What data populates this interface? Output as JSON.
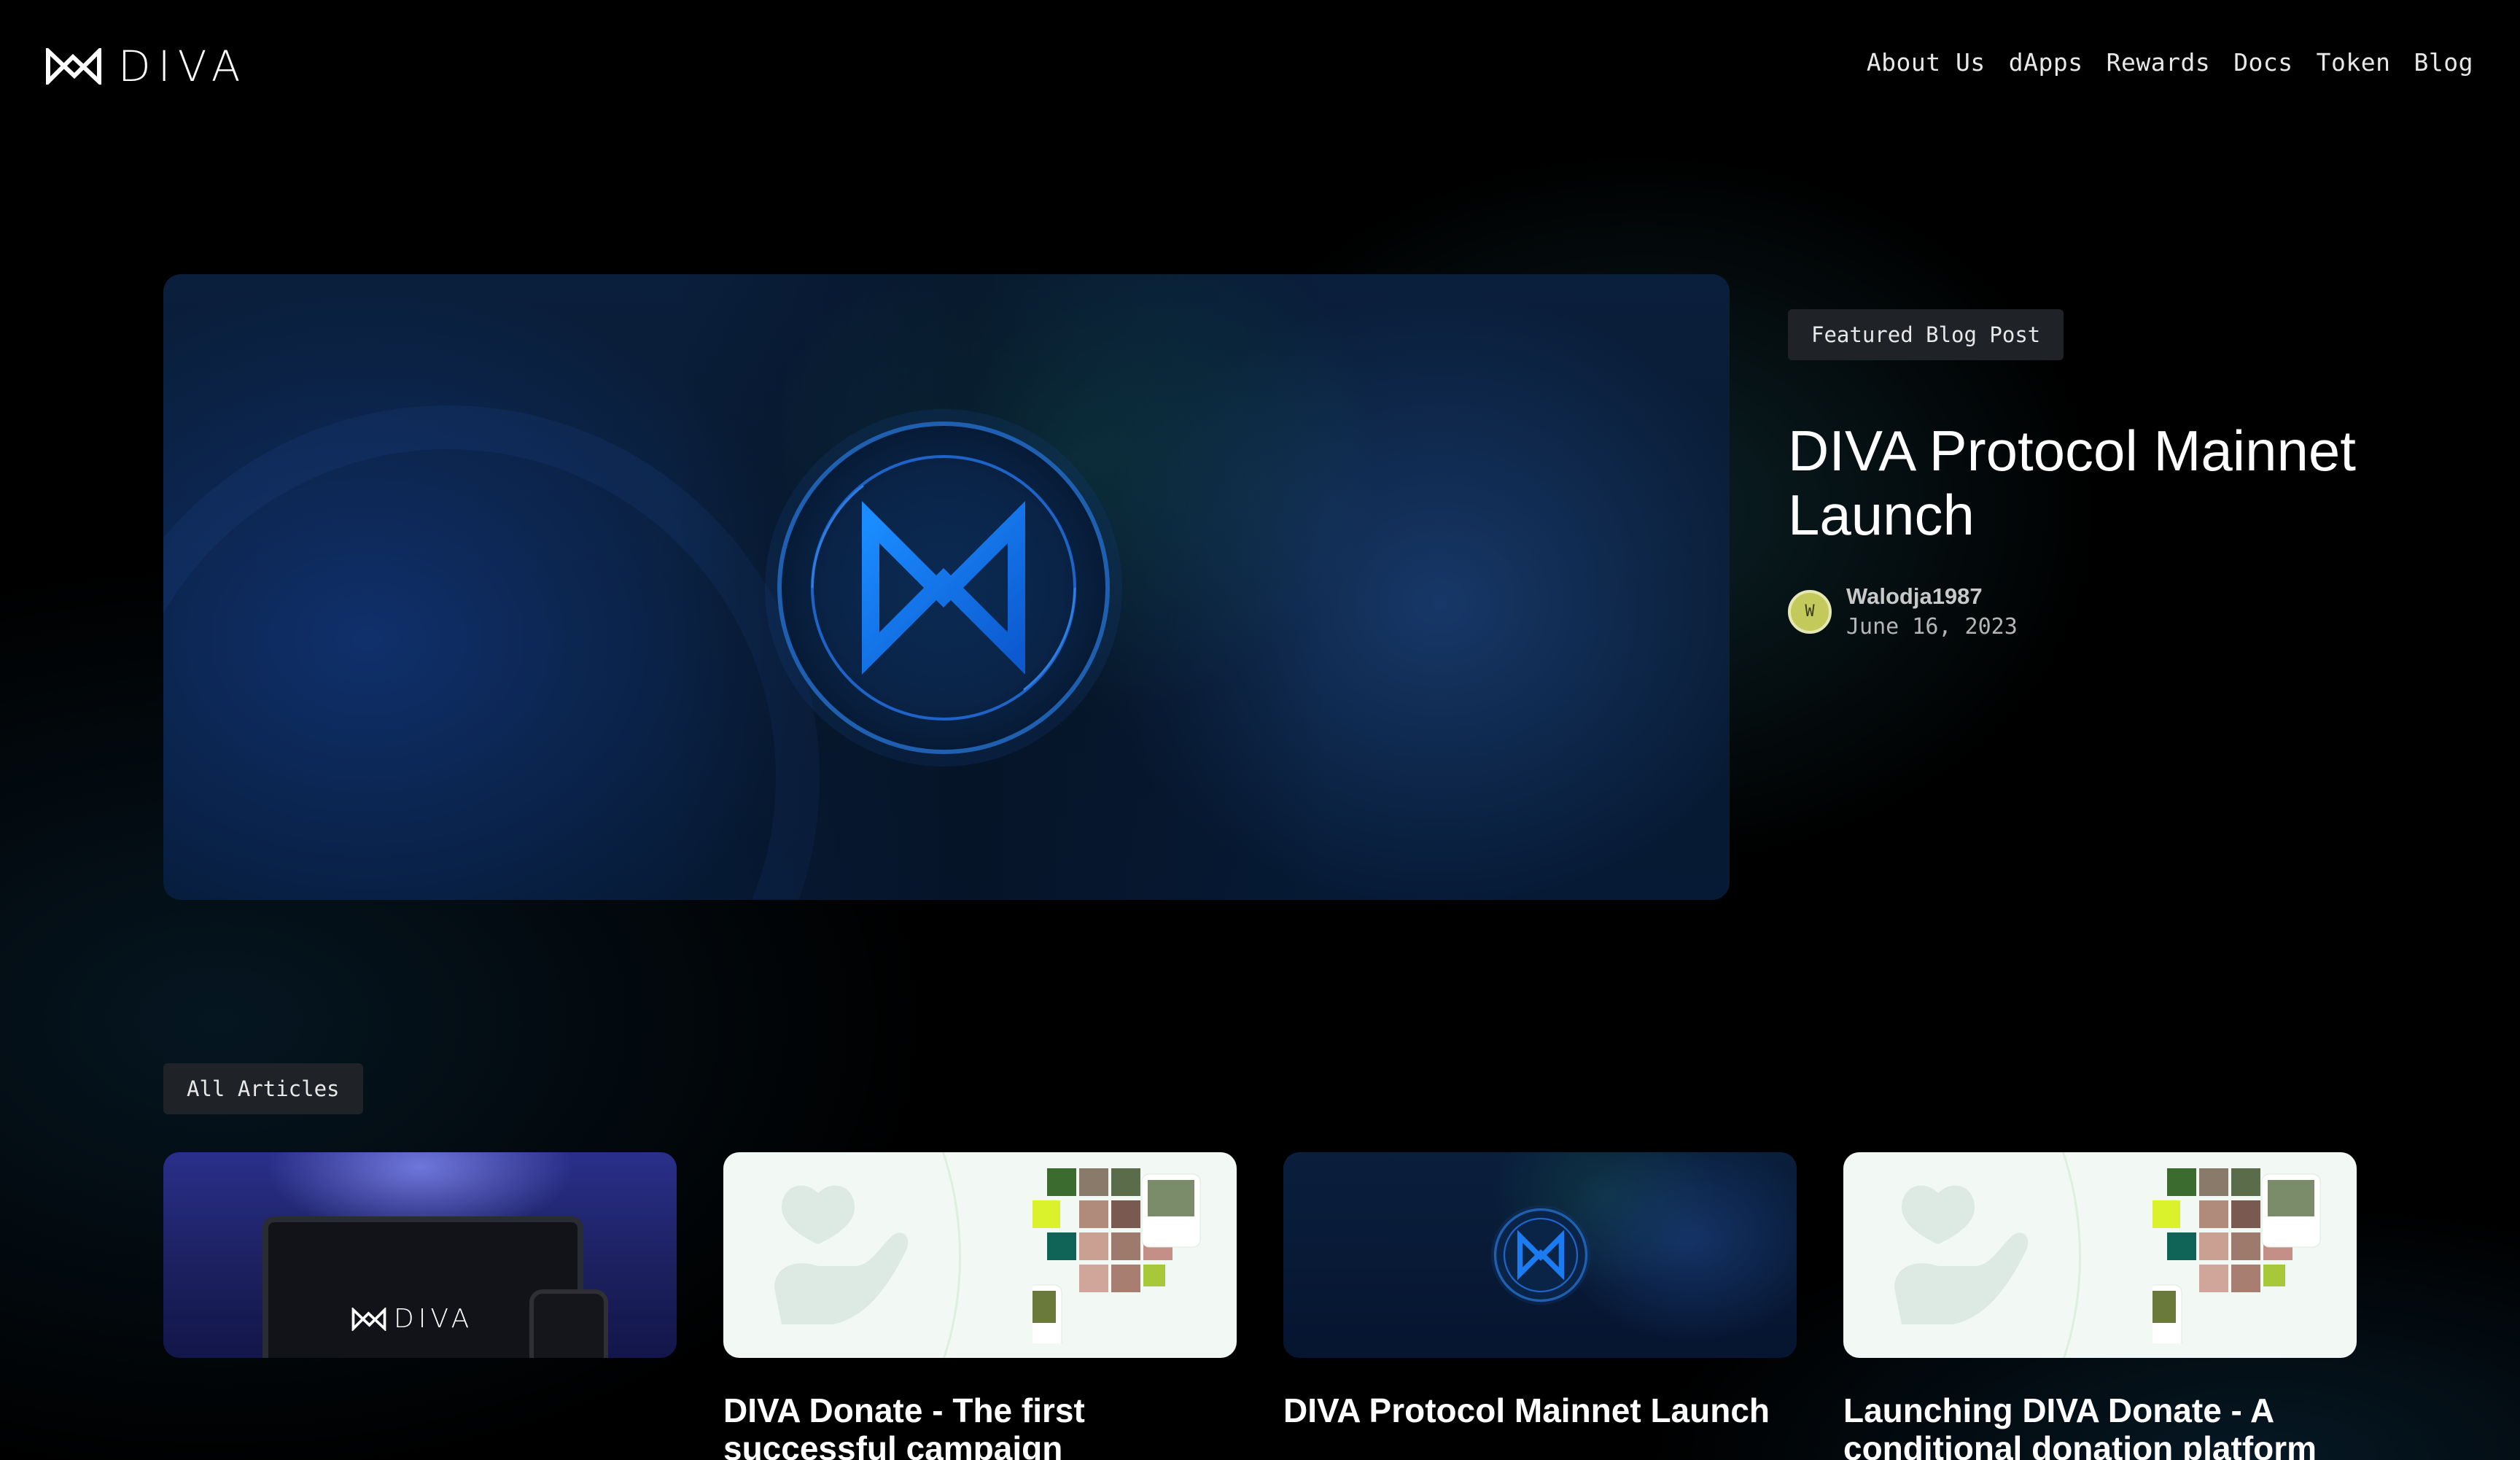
{
  "header": {
    "logo_text": "DIVA",
    "nav": [
      {
        "label": "About Us"
      },
      {
        "label": "dApps"
      },
      {
        "label": "Rewards"
      },
      {
        "label": "Docs"
      },
      {
        "label": "Token"
      },
      {
        "label": "Blog"
      }
    ]
  },
  "featured": {
    "tag": "Featured Blog Post",
    "title": "DIVA Protocol Mainnet Launch",
    "author": {
      "initial": "W",
      "name": "Walodja1987",
      "date": "June 16, 2023"
    }
  },
  "articles": {
    "tag": "All Articles",
    "laptop_logo_text": "DIVA",
    "cards": [
      {
        "title": "",
        "thumb": "laptop-phone-image"
      },
      {
        "title": "DIVA Donate - The first successful campaign completed",
        "thumb": "donate-image"
      },
      {
        "title": "DIVA Protocol Mainnet Launch",
        "thumb": "mainnet-image"
      },
      {
        "title": "Launching DIVA Donate - A conditional donation platform",
        "thumb": "donate-image"
      }
    ]
  },
  "colors": {
    "background": "#000000",
    "accent_blue": "#1a6fe0",
    "tag_bg": "#1f2226",
    "avatar": "#c3c95a"
  }
}
